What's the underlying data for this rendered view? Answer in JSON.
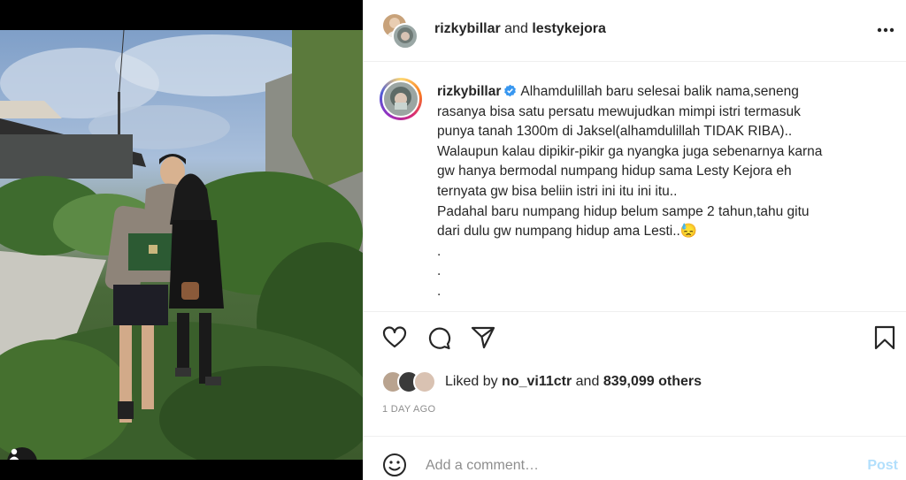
{
  "header": {
    "user1": "rizkybillar",
    "joiner": "and",
    "user2": "lestykejora",
    "more_icon": "more-horizontal-icon"
  },
  "caption": {
    "username": "rizkybillar",
    "verified_icon": "verified-badge-icon",
    "lines": [
      "Alhamdulillah baru selesai balik nama,seneng",
      "rasanya bisa satu persatu mewujudkan mimpi istri termasuk",
      "punya tanah 1300m di Jaksel(alhamdulillah TIDAK RIBA)..",
      "Walaupun kalau dipikir-pikir ga nyangka juga sebenarnya karna",
      "gw hanya bermodal numpang hidup sama Lesty Kejora eh",
      "ternyata gw bisa beliin istri ini itu ini itu..",
      "Padahal baru numpang hidup belum sampe 2 tahun,tahu gitu",
      "dari dulu gw numpang hidup ama Lesti..",
      ".",
      ".",
      "."
    ],
    "emoji": "😓"
  },
  "actions": {
    "like_icon": "heart-icon",
    "comment_icon": "comment-icon",
    "share_icon": "send-icon",
    "save_icon": "bookmark-icon"
  },
  "likes": {
    "prefix": "Liked by",
    "user": "no_vi11ctr",
    "middle": "and",
    "count": "839,099 others"
  },
  "timestamp": "1 DAY AGO",
  "comment": {
    "placeholder": "Add a comment…",
    "post_label": "Post",
    "emoji_icon": "smiley-icon"
  },
  "photo": {
    "tag_icon": "user-tag-icon"
  },
  "colors": {
    "verified": "#3897f0",
    "post_disabled": "#b2dffc",
    "secondary_text": "#8e8e8e"
  }
}
